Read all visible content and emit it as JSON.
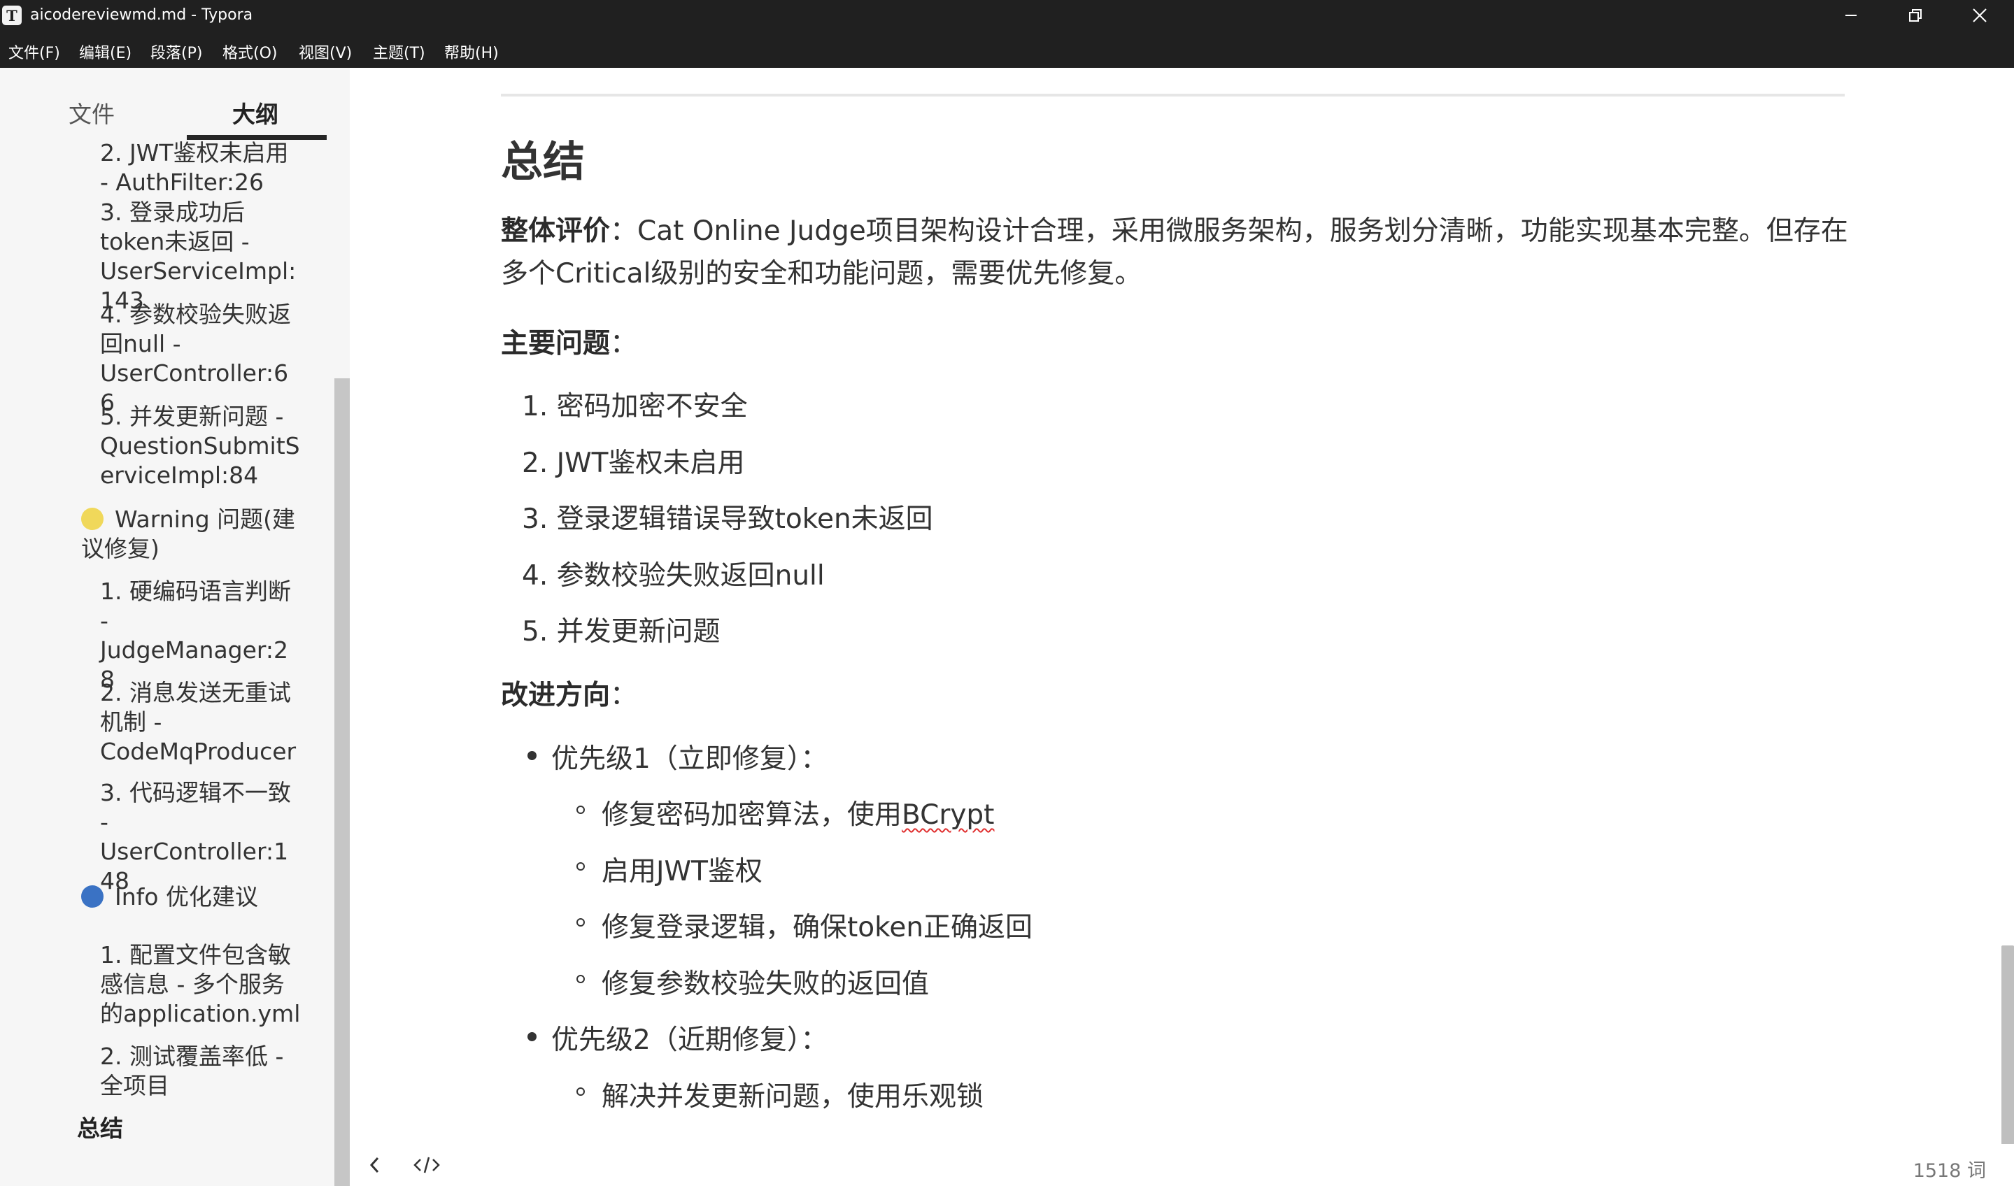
{
  "window": {
    "icon_letter": "T",
    "title": "aicodereviewmd.md - Typora"
  },
  "menu": [
    "文件(F)",
    "编辑(E)",
    "段落(P)",
    "格式(O)",
    "视图(V)",
    "主题(T)",
    "帮助(H)"
  ],
  "sidebar": {
    "tabs": [
      "文件",
      "大纲"
    ],
    "active_tab": "大纲",
    "outline": [
      {
        "text": "2. JWT鉴权未启用 - AuthFilter:26",
        "level": 2
      },
      {
        "text": "3. 登录成功后token未返回 - UserServiceImpl:143",
        "level": 2
      },
      {
        "text": "4. 参数校验失败返回null - UserController:66",
        "level": 2
      },
      {
        "text": "5. 并发更新问题 - QuestionSubmitServiceImpl:84",
        "level": 2
      },
      {
        "text": "Warning 问题(建议修复)",
        "level": 1,
        "dot_color": "#f0d85a"
      },
      {
        "text": "1. 硬编码语言判断 - JudgeManager:28",
        "level": 2
      },
      {
        "text": "2. 消息发送无重试机制 - CodeMqProducer",
        "level": 2
      },
      {
        "text": "3. 代码逻辑不一致 - UserController:148",
        "level": 2
      },
      {
        "text": "Info 优化建议",
        "level": 1,
        "dot_color": "#3a72c4"
      },
      {
        "text": "1. 配置文件包含敏感信息 - 多个服务的application.yml",
        "level": 2
      },
      {
        "text": "2. 测试覆盖率低 - 全项目",
        "level": 2
      },
      {
        "text": "总结",
        "level": 0
      }
    ]
  },
  "document": {
    "heading": "总结",
    "overall_label": "整体评价",
    "overall_text": "：Cat Online Judge项目架构设计合理，采用微服务架构，服务划分清晰，功能实现基本完整。但存在多个Critical级别的安全和功能问题，需要优先修复。",
    "issues_label": "主要问题",
    "issues_colon": "：",
    "issues": [
      "1. 密码加密不安全",
      "2. JWT鉴权未启用",
      "3. 登录逻辑错误导致token未返回",
      "4. 参数校验失败返回null",
      "5. 并发更新问题"
    ],
    "improve_label": "改进方向",
    "improve_colon": "：",
    "priority1": "优先级1（立即修复）：",
    "priority1_items": [
      {
        "prefix": "修复密码加密算法，使用",
        "spell": "BCrypt"
      },
      {
        "prefix": "启用JWT鉴权",
        "spell": ""
      },
      {
        "prefix": "修复登录逻辑，确保token正确返回",
        "spell": ""
      },
      {
        "prefix": "修复参数校验失败的返回值",
        "spell": ""
      }
    ],
    "priority2": "优先级2（近期修复）：",
    "priority2_items": [
      "解决并发更新问题，使用乐观锁"
    ]
  },
  "footer": {
    "word_count": "1518 词"
  }
}
